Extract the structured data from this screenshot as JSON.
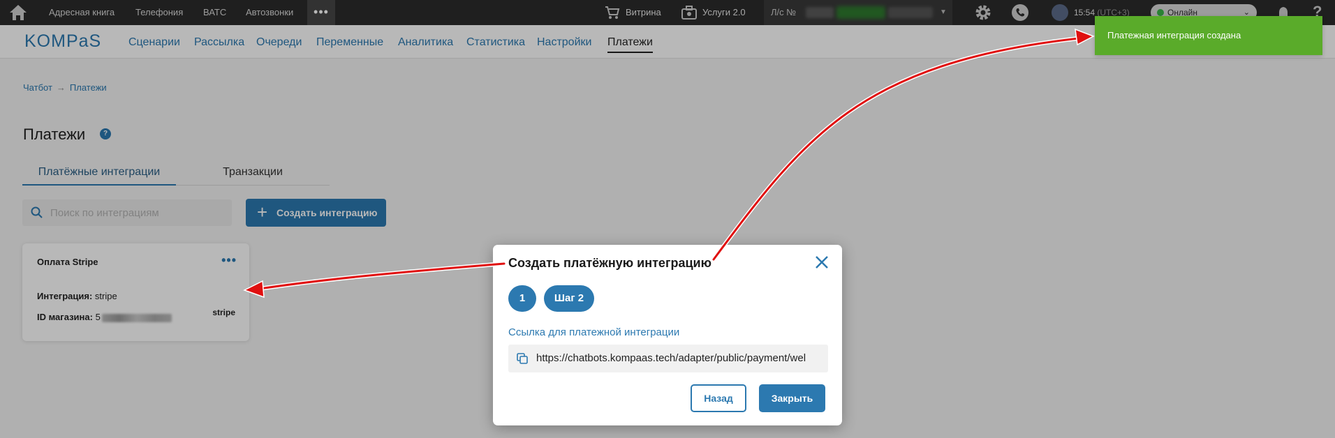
{
  "topbar": {
    "items": [
      "Адресная книга",
      "Телефония",
      "ВАТС",
      "Автозвонки"
    ],
    "more": "•••",
    "showcase": "Витрина",
    "services": "Услуги 2.0",
    "account_label": "Л/с №",
    "time": "15:54",
    "timezone": "(UTC+3)",
    "status": "Онлайн"
  },
  "navbar": {
    "logo": "KOMPaS",
    "items": [
      "Сценарии",
      "Рассылка",
      "Очереди",
      "Переменные",
      "Аналитика",
      "Статистика",
      "Настройки",
      "Платежи"
    ]
  },
  "breadcrumb": {
    "root": "Чатбот",
    "current": "Платежи"
  },
  "page": {
    "title": "Платежи",
    "help": "?",
    "tabs": [
      "Платёжные интеграции",
      "Транзакции"
    ],
    "search_placeholder": "Поиск по интеграциям",
    "create_button": "Создать интеграцию"
  },
  "card": {
    "title": "Оплата Stripe",
    "menu": "•••",
    "integration_label": "Интеграция:",
    "integration_value": "stripe",
    "shop_id_label": "ID магазина:",
    "shop_id_value": "5",
    "brand": "stripe"
  },
  "modal": {
    "title": "Создать платёжную интеграцию",
    "step1": "1",
    "step2": "Шаг 2",
    "field_label": "Ссылка для платежной интеграции",
    "url": "https://chatbots.kompaas.tech/adapter/public/payment/wel",
    "back_button": "Назад",
    "close_button": "Закрыть"
  },
  "toast": {
    "text": "Платежная интеграция создана"
  },
  "colors": {
    "accent": "#2c79b0",
    "toast": "#5aab2a",
    "topbar": "#2b2b2b",
    "arrow": "#e01010"
  }
}
